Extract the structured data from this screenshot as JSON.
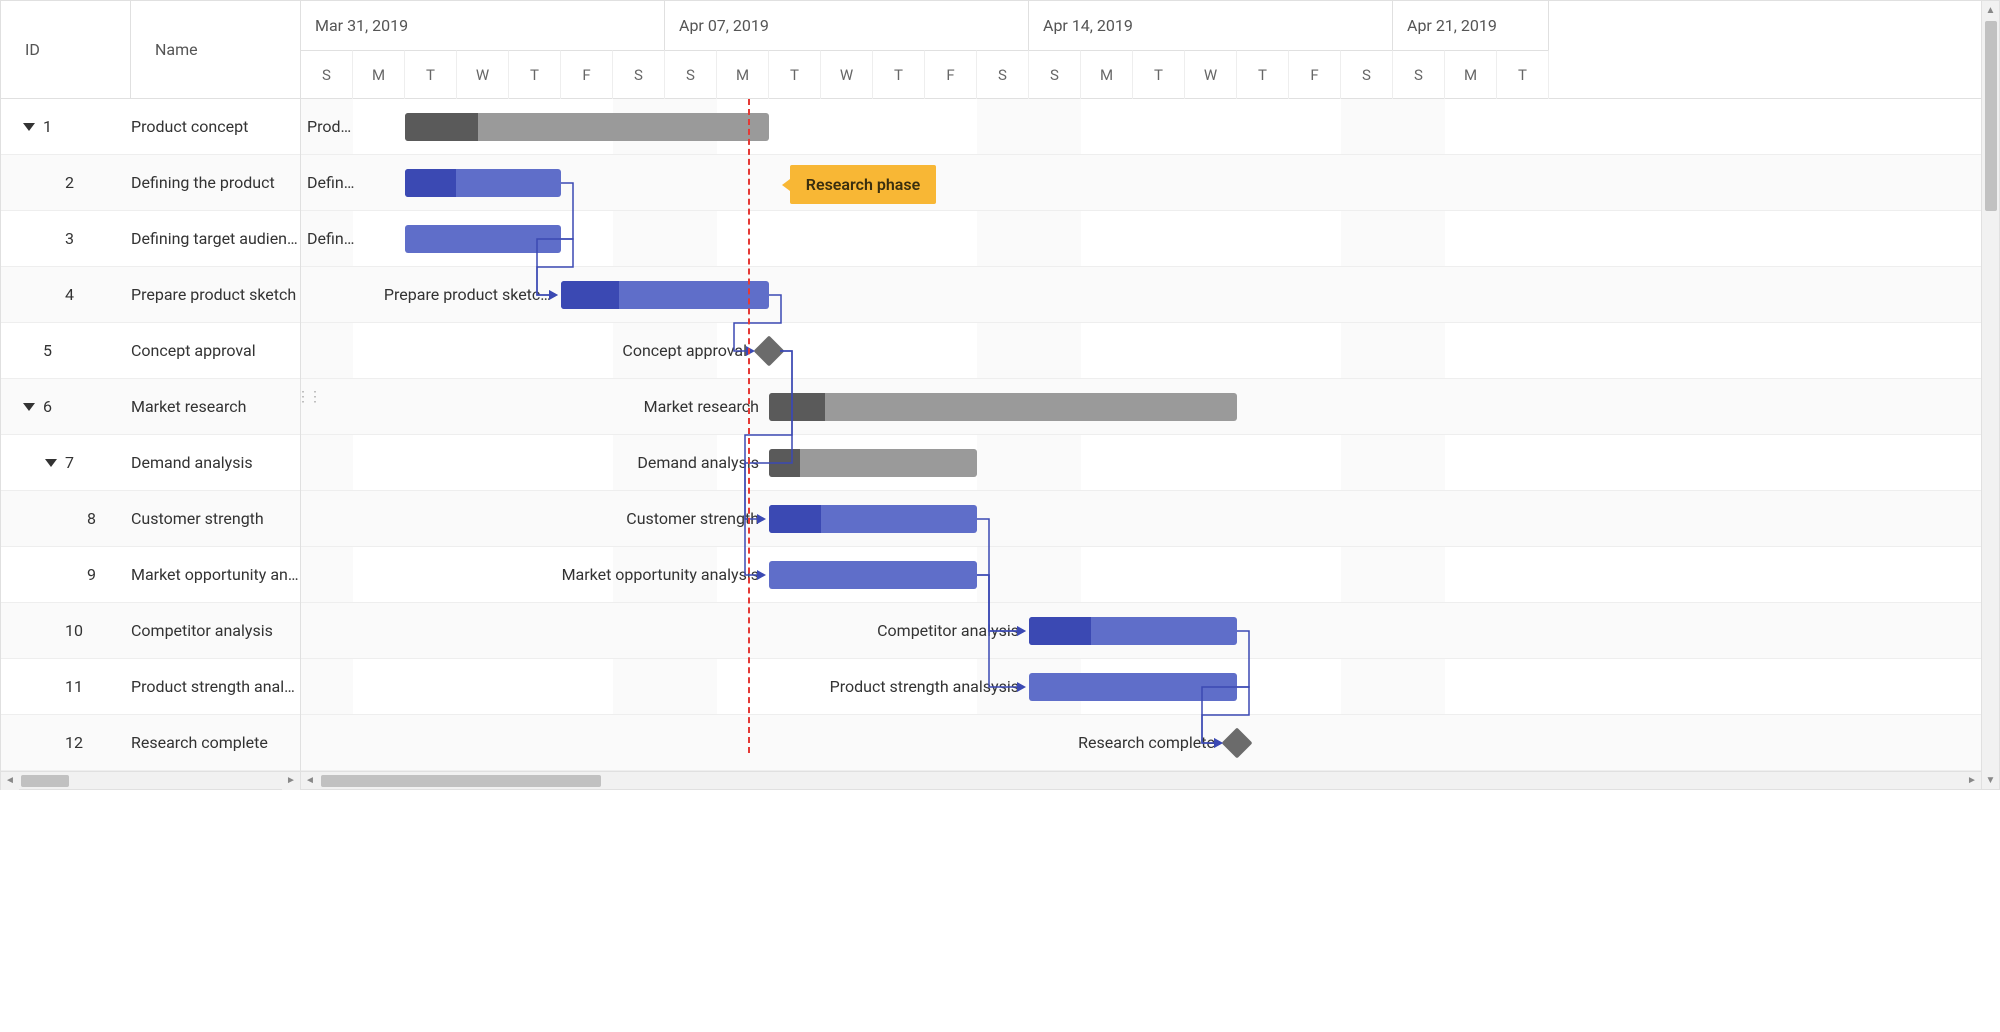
{
  "chart_data": {
    "type": "gantt",
    "title": "",
    "time_axis": {
      "unit": "day",
      "start": "2019-03-31",
      "weeks": [
        "Mar 31, 2019",
        "Apr 07, 2019",
        "Apr 14, 2019",
        "Apr 21, 2019"
      ],
      "days": [
        "S",
        "M",
        "T",
        "W",
        "T",
        "F",
        "S",
        "S",
        "M",
        "T",
        "W",
        "T",
        "F",
        "S",
        "S",
        "M",
        "T",
        "W",
        "T",
        "F",
        "S",
        "S",
        "M",
        "T"
      ],
      "current_date_index": 8.6
    },
    "columns": {
      "id": "ID",
      "name": "Name"
    },
    "rows": [
      {
        "id": 1,
        "name": "Product concept",
        "indent": 0,
        "expandable": true,
        "type": "summary",
        "start": 2,
        "duration": 7,
        "progress": 0.2,
        "label": "Prod…",
        "labelPos": "inside"
      },
      {
        "id": 2,
        "name": "Defining the product",
        "indent": 1,
        "type": "task",
        "start": 2,
        "duration": 3,
        "progress": 0.33,
        "label": "Defin…",
        "labelPos": "inside"
      },
      {
        "id": 3,
        "name": "Defining target audience",
        "indent": 1,
        "type": "task",
        "start": 2,
        "duration": 3,
        "progress": 0,
        "label": "Defin…",
        "labelPos": "inside"
      },
      {
        "id": 4,
        "name": "Prepare product sketch",
        "indent": 1,
        "type": "task",
        "start": 5,
        "duration": 4,
        "progress": 0.28,
        "label": "Prepare product sketc…",
        "labelPos": "left",
        "predecessors": [
          2,
          3
        ]
      },
      {
        "id": 5,
        "name": "Concept approval",
        "indent": 0,
        "type": "milestone",
        "start": 9,
        "label": "Concept approval",
        "labelPos": "left",
        "predecessors": [
          4
        ]
      },
      {
        "id": 6,
        "name": "Market research",
        "indent": 0,
        "expandable": true,
        "type": "summary",
        "start": 9,
        "duration": 9,
        "progress": 0.12,
        "label": "Market research",
        "labelPos": "left"
      },
      {
        "id": 7,
        "name": "Demand analysis",
        "indent": 1,
        "expandable": true,
        "type": "summary",
        "start": 9,
        "duration": 4,
        "progress": 0.15,
        "label": "Demand analysis",
        "labelPos": "left"
      },
      {
        "id": 8,
        "name": "Customer strength",
        "indent": 2,
        "type": "task",
        "start": 9,
        "duration": 4,
        "progress": 0.25,
        "label": "Customer strength",
        "labelPos": "left",
        "predecessors": [
          5
        ]
      },
      {
        "id": 9,
        "name": "Market opportunity analysis",
        "indent": 2,
        "type": "task",
        "start": 9,
        "duration": 4,
        "progress": 0,
        "label": "Market opportunity analysis",
        "labelPos": "left",
        "predecessors": [
          5
        ]
      },
      {
        "id": 10,
        "name": "Competitor analysis",
        "indent": 1,
        "type": "task",
        "start": 14,
        "duration": 4,
        "progress": 0.3,
        "label": "Competitor analysis",
        "labelPos": "left",
        "predecessors": [
          8,
          9
        ]
      },
      {
        "id": 11,
        "name": "Product strength analsysis",
        "indent": 1,
        "type": "task",
        "start": 14,
        "duration": 4,
        "progress": 0,
        "label": "Product strength analsysis",
        "labelPos": "left",
        "predecessors": [
          9
        ]
      },
      {
        "id": 12,
        "name": "Research complete",
        "indent": 1,
        "type": "milestone",
        "start": 18,
        "label": "Research complete",
        "labelPos": "left",
        "predecessors": [
          10,
          11
        ]
      }
    ],
    "marker": {
      "text": "Research phase",
      "row": 1,
      "left_day": 9.4
    }
  }
}
